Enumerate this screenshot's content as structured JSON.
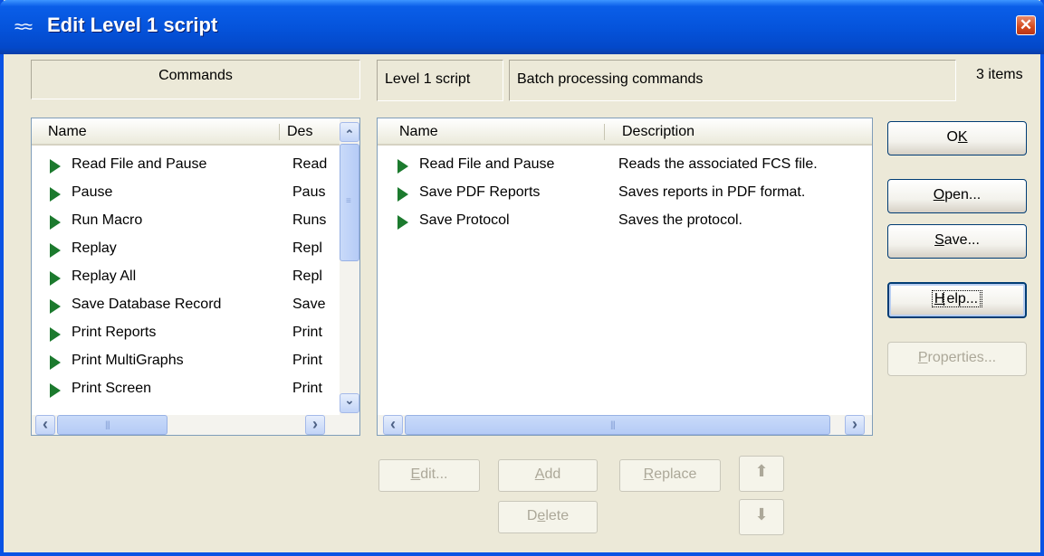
{
  "window": {
    "title": "Edit Level 1 script",
    "title_icon": "waves-icon",
    "close_glyph": "✕"
  },
  "commands_panel": {
    "label": "Commands"
  },
  "script_panel": {
    "label": "Level 1 script",
    "description": "Batch processing commands"
  },
  "item_count": "3 items",
  "commands_list": {
    "columns": [
      "Name",
      "Des"
    ],
    "rows": [
      {
        "name": "Read File and Pause",
        "desc": "Read"
      },
      {
        "name": "Pause",
        "desc": "Paus"
      },
      {
        "name": "Run Macro",
        "desc": "Runs"
      },
      {
        "name": "Replay",
        "desc": "Repl"
      },
      {
        "name": "Replay All",
        "desc": "Repl"
      },
      {
        "name": "Save Database Record",
        "desc": "Save"
      },
      {
        "name": "Print Reports",
        "desc": "Print"
      },
      {
        "name": "Print MultiGraphs",
        "desc": "Print"
      },
      {
        "name": "Print Screen",
        "desc": "Print"
      }
    ]
  },
  "script_list": {
    "columns": [
      "Name",
      "Description"
    ],
    "rows": [
      {
        "name": "Read File and Pause",
        "desc": "Reads the associated FCS file."
      },
      {
        "name": "Save PDF Reports",
        "desc": "Saves reports in PDF format."
      },
      {
        "name": "Save Protocol",
        "desc": "Saves the protocol."
      }
    ]
  },
  "buttons": {
    "ok": {
      "label": "OK",
      "mnemonic": "K",
      "pre": "O",
      "post": ""
    },
    "open": {
      "label": "Open...",
      "pre": "",
      "mnemonic": "O",
      "post": "pen..."
    },
    "save": {
      "label": "Save...",
      "pre": "",
      "mnemonic": "S",
      "post": "ave..."
    },
    "help": {
      "label": "Help...",
      "pre": "",
      "mnemonic": "H",
      "post": "elp..."
    },
    "properties": {
      "label": "Properties...",
      "pre": "",
      "mnemonic": "P",
      "post": "roperties..."
    },
    "edit": {
      "label": "Edit...",
      "pre": "",
      "mnemonic": "E",
      "post": "dit..."
    },
    "add": {
      "label": "Add",
      "pre": "",
      "mnemonic": "A",
      "post": "dd"
    },
    "replace": {
      "label": "Replace",
      "pre": "",
      "mnemonic": "R",
      "post": "eplace"
    },
    "delete": {
      "label": "Delete",
      "pre": "D",
      "mnemonic": "e",
      "post": "lete"
    },
    "move_up": {
      "icon": "arrow-up-icon",
      "glyph": "⬆"
    },
    "move_down": {
      "icon": "arrow-down-icon",
      "glyph": "⬇"
    }
  },
  "scroll_glyphs": {
    "up": "⌃",
    "down": "⌄",
    "left": "‹",
    "right": "›"
  },
  "colors": {
    "title_bar": "#0554dc",
    "command_icon": "#1c7a2e",
    "dialog_bg": "#ece9d8"
  }
}
